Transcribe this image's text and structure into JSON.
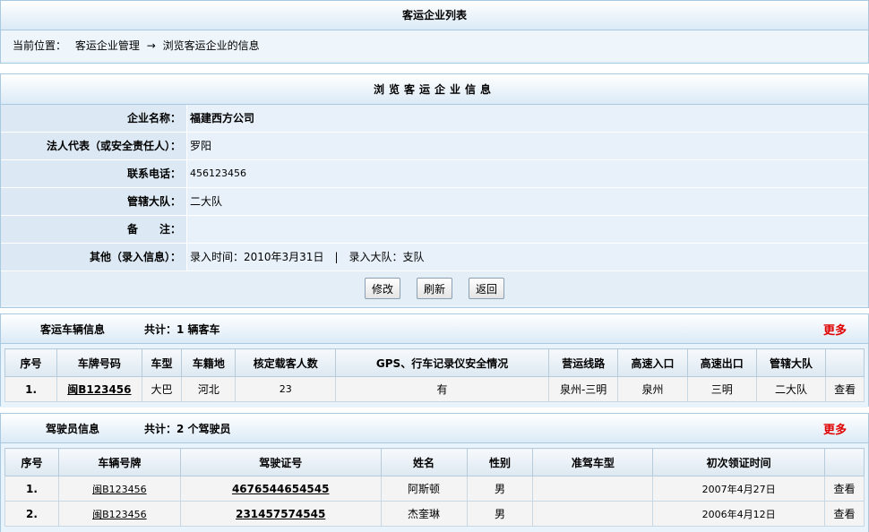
{
  "top": {
    "title": "客运企业列表",
    "crumb_prefix": "当前位置：",
    "crumb_parent": "客运企业管理",
    "crumb_arrow": "→",
    "crumb_current": "浏览客运企业的信息"
  },
  "info": {
    "title": "浏览客运企业信息",
    "rows": [
      {
        "label": "企业名称：",
        "value": "福建西方公司"
      },
      {
        "label": "法人代表（或安全责任人）：",
        "value": "罗阳"
      },
      {
        "label": "联系电话：",
        "value": "456123456"
      },
      {
        "label": "管辖大队：",
        "value": "二大队"
      },
      {
        "label": "备　　注：",
        "value": ""
      },
      {
        "label": "其他（录入信息）：",
        "value": "录入时间：2010年3月31日　|　录入大队：支队"
      }
    ],
    "buttons": {
      "edit": "修改",
      "refresh": "刷新",
      "back": "返回"
    }
  },
  "vehicles": {
    "title": "客运车辆信息",
    "count_text": "共计：1 辆客车",
    "more": "更多",
    "columns": [
      "序号",
      "车牌号码",
      "车型",
      "车籍地",
      "核定载客人数",
      "GPS、行车记录仪安全情况",
      "营运线路",
      "高速入口",
      "高速出口",
      "管辖大队",
      ""
    ],
    "rows": [
      {
        "no": "1.",
        "plate": "闽B123456",
        "type": "大巴",
        "origin": "河北",
        "seats": "23",
        "gps": "有",
        "route": "泉州-三明",
        "entry": "泉州",
        "exit": "三明",
        "brigade": "二大队",
        "action": "查看"
      }
    ]
  },
  "drivers": {
    "title": "驾驶员信息",
    "count_text": "共计：2 个驾驶员",
    "more": "更多",
    "columns": [
      "序号",
      "车辆号牌",
      "驾驶证号",
      "姓名",
      "性别",
      "准驾车型",
      "初次领证时间",
      ""
    ],
    "rows": [
      {
        "no": "1.",
        "plate": "闽B123456",
        "license": "4676544654545",
        "name": "阿斯顿",
        "gender": "男",
        "class": "",
        "date": "2007年4月27日",
        "action": "查看"
      },
      {
        "no": "2.",
        "plate": "闽B123456",
        "license": "231457574545",
        "name": "杰奎琳",
        "gender": "男",
        "class": "",
        "date": "2006年4月12日",
        "action": "查看"
      }
    ]
  }
}
